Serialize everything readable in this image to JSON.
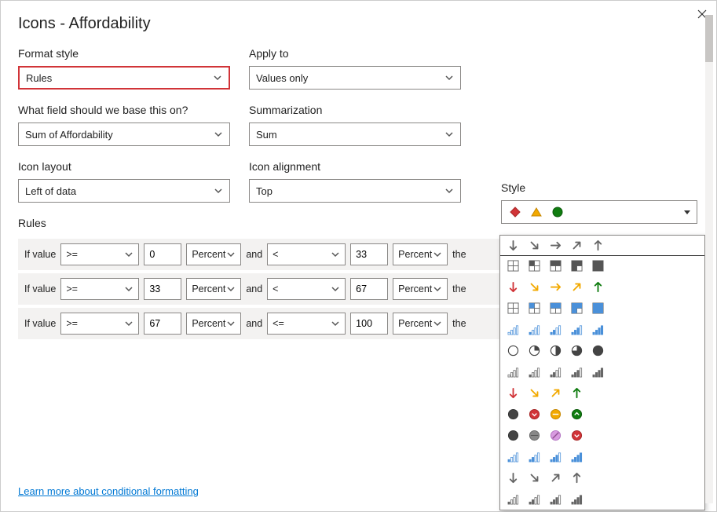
{
  "title": "Icons - Affordability",
  "labels": {
    "formatStyle": "Format style",
    "applyTo": "Apply to",
    "baseField": "What field should we base this on?",
    "summarization": "Summarization",
    "iconLayout": "Icon layout",
    "iconAlignment": "Icon alignment",
    "style": "Style",
    "rules": "Rules",
    "ifValue": "If value",
    "and": "and",
    "then": "the"
  },
  "values": {
    "formatStyle": "Rules",
    "applyTo": "Values only",
    "baseField": "Sum of Affordability",
    "summarization": "Sum",
    "iconLayout": "Left of data",
    "iconAlignment": "Top"
  },
  "rules": [
    {
      "op1": ">=",
      "val1": "0",
      "unit1": "Percent",
      "op2": "<",
      "val2": "33",
      "unit2": "Percent"
    },
    {
      "op1": ">=",
      "val1": "33",
      "unit1": "Percent",
      "op2": "<",
      "val2": "67",
      "unit2": "Percent"
    },
    {
      "op1": ">=",
      "val1": "67",
      "unit1": "Percent",
      "op2": "<=",
      "val2": "100",
      "unit2": "Percent"
    }
  ],
  "learnMore": "Learn more about conditional formatting",
  "selectedStyle": "diamond-triangle-circle"
}
